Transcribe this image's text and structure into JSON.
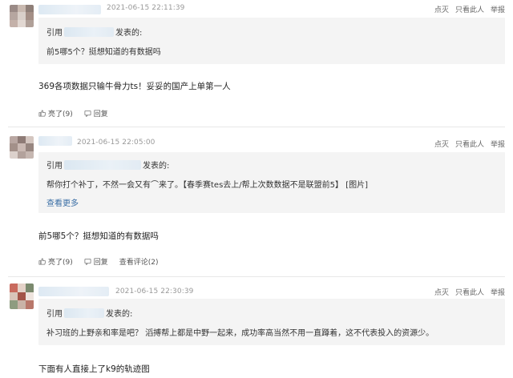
{
  "posts": [
    {
      "timestamp": "2021-06-15 22:11:39",
      "actions": {
        "like": "点灭",
        "only_author": "只看此人",
        "report": "举报"
      },
      "quote": {
        "prefix": "引用",
        "suffix": "发表的:",
        "text": "前5哪5个？挺想知道的有数据吗"
      },
      "body": "369各项数据只输牛骨力ts！妥妥的国产上单第一人",
      "bottom": {
        "liked": "亮了(9)",
        "reply": "回复"
      }
    },
    {
      "timestamp": "2021-06-15 22:05:00",
      "actions": {
        "like": "点灭",
        "only_author": "只看此人",
        "report": "举报"
      },
      "quote": {
        "prefix": "引用",
        "suffix": "发表的:",
        "text": "帮你打个补丁，不然一会又有⌒来了。【春季赛tes去上/帮上次数数据不是联盟前5】 [图片]",
        "more": "查看更多"
      },
      "body": "前5哪5个？挺想知道的有数据吗",
      "bottom": {
        "liked": "亮了(9)",
        "reply": "回复",
        "view_comments": "查看评论(2)"
      }
    },
    {
      "timestamp": "2021-06-15 22:30:39",
      "actions": {
        "like": "点灭",
        "only_author": "只看此人",
        "report": "举报"
      },
      "quote": {
        "prefix": "引用",
        "suffix": "发表的:",
        "text": "补习班的上野亲和率是吧？ 滔搏帮上都是中野一起来，成功率高当然不用一直蹲着，这不代表投入的资源少。"
      },
      "body": "下面有人直接上了k9的轨迹图"
    }
  ],
  "colors": {
    "link": "#3a6ea5",
    "quote_bg": "#f4f4f4",
    "muted": "#999999"
  }
}
